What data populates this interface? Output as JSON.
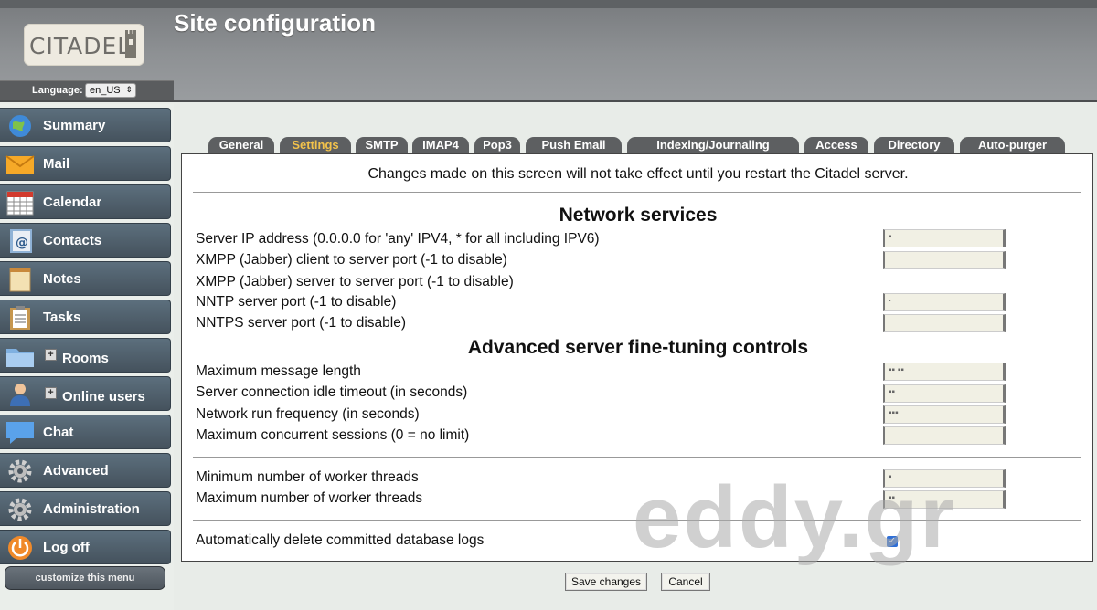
{
  "app": {
    "name": "CITADEL"
  },
  "header": {
    "title": "Site configuration",
    "language_label": "Language:",
    "language_value": "en_US"
  },
  "sidebar": {
    "items": [
      {
        "label": "Summary",
        "icon": "globe-icon"
      },
      {
        "label": "Mail",
        "icon": "envelope-icon"
      },
      {
        "label": "Calendar",
        "icon": "calendar-icon"
      },
      {
        "label": "Contacts",
        "icon": "address-book-icon"
      },
      {
        "label": "Notes",
        "icon": "notepad-icon"
      },
      {
        "label": "Tasks",
        "icon": "clipboard-icon"
      },
      {
        "label": "Rooms",
        "icon": "folder-icon",
        "expandable": true
      },
      {
        "label": "Online users",
        "icon": "user-icon",
        "expandable": true
      },
      {
        "label": "Chat",
        "icon": "chat-bubble-icon"
      },
      {
        "label": "Advanced",
        "icon": "gear-icon"
      },
      {
        "label": "Administration",
        "icon": "gear-icon"
      },
      {
        "label": "Log off",
        "icon": "power-icon"
      }
    ],
    "customize_label": "customize this menu"
  },
  "tabs": [
    {
      "label": "General",
      "active": false
    },
    {
      "label": "Settings",
      "active": true
    },
    {
      "label": "SMTP",
      "active": false
    },
    {
      "label": "IMAP4",
      "active": false
    },
    {
      "label": "Pop3",
      "active": false
    },
    {
      "label": "Push Email",
      "active": false
    },
    {
      "label": "Indexing/Journaling",
      "active": false
    },
    {
      "label": "Access",
      "active": false
    },
    {
      "label": "Directory",
      "active": false
    },
    {
      "label": "Auto-purger",
      "active": false
    }
  ],
  "notice": "Changes made on this screen will not take effect until you restart the Citadel server.",
  "sections": {
    "network": "Network services",
    "advanced": "Advanced server fine-tuning controls"
  },
  "fields": {
    "server_ip": "Server IP address (0.0.0.0 for 'any' IPV4, * for all including IPV6)",
    "xmpp_client": "XMPP (Jabber) client to server port (-1 to disable)",
    "xmpp_server": "XMPP (Jabber) server to server port (-1 to disable)",
    "nntp": "NNTP server port (-1 to disable)",
    "nntps": "NNTPS server port (-1 to disable)",
    "max_msg_len": "Maximum message length",
    "idle_timeout": "Server connection idle timeout (in seconds)",
    "net_run_freq": "Network run frequency (in seconds)",
    "max_sessions": "Maximum concurrent sessions (0 = no limit)",
    "min_workers": "Minimum number of worker threads",
    "max_workers": "Maximum number of worker threads",
    "auto_delete_logs": "Automatically delete committed database logs"
  },
  "values": {
    "auto_delete_logs_checked": true
  },
  "buttons": {
    "save": "Save changes",
    "cancel": "Cancel"
  },
  "watermark": "eddy.gr",
  "colors": {
    "active_tab": "#f2c24b",
    "nav_bg": "#4f5d68"
  }
}
